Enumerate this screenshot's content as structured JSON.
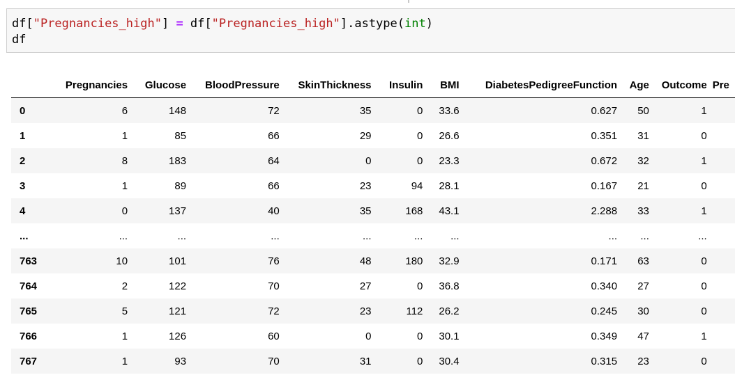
{
  "code_cell": {
    "line1_prefix": "df[",
    "line1_str1": "\"Pregnancies_high\"",
    "line1_mid": "] ",
    "line1_op": "=",
    "line1_mid2": " df[",
    "line1_str2": "\"Pregnancies_high\"",
    "line1_mid3": "].astype(",
    "line1_builtin": "int",
    "line1_end": ")",
    "line2": "df"
  },
  "table": {
    "columns": [
      "",
      "Pregnancies",
      "Glucose",
      "BloodPressure",
      "SkinThickness",
      "Insulin",
      "BMI",
      "DiabetesPedigreeFunction",
      "Age",
      "Outcome",
      "Pre"
    ],
    "rows": [
      {
        "index": "0",
        "cells": [
          "6",
          "148",
          "72",
          "35",
          "0",
          "33.6",
          "0.627",
          "50",
          "1",
          ""
        ]
      },
      {
        "index": "1",
        "cells": [
          "1",
          "85",
          "66",
          "29",
          "0",
          "26.6",
          "0.351",
          "31",
          "0",
          ""
        ]
      },
      {
        "index": "2",
        "cells": [
          "8",
          "183",
          "64",
          "0",
          "0",
          "23.3",
          "0.672",
          "32",
          "1",
          ""
        ]
      },
      {
        "index": "3",
        "cells": [
          "1",
          "89",
          "66",
          "23",
          "94",
          "28.1",
          "0.167",
          "21",
          "0",
          ""
        ]
      },
      {
        "index": "4",
        "cells": [
          "0",
          "137",
          "40",
          "35",
          "168",
          "43.1",
          "2.288",
          "33",
          "1",
          ""
        ]
      },
      {
        "index": "...",
        "cells": [
          "...",
          "...",
          "...",
          "...",
          "...",
          "...",
          "...",
          "...",
          "...",
          ""
        ]
      },
      {
        "index": "763",
        "cells": [
          "10",
          "101",
          "76",
          "48",
          "180",
          "32.9",
          "0.171",
          "63",
          "0",
          ""
        ]
      },
      {
        "index": "764",
        "cells": [
          "2",
          "122",
          "70",
          "27",
          "0",
          "36.8",
          "0.340",
          "27",
          "0",
          ""
        ]
      },
      {
        "index": "765",
        "cells": [
          "5",
          "121",
          "72",
          "23",
          "112",
          "26.2",
          "0.245",
          "30",
          "0",
          ""
        ]
      },
      {
        "index": "766",
        "cells": [
          "1",
          "126",
          "60",
          "0",
          "0",
          "30.1",
          "0.349",
          "47",
          "1",
          ""
        ]
      },
      {
        "index": "767",
        "cells": [
          "1",
          "93",
          "70",
          "31",
          "0",
          "30.4",
          "0.315",
          "23",
          "0",
          ""
        ]
      }
    ]
  }
}
